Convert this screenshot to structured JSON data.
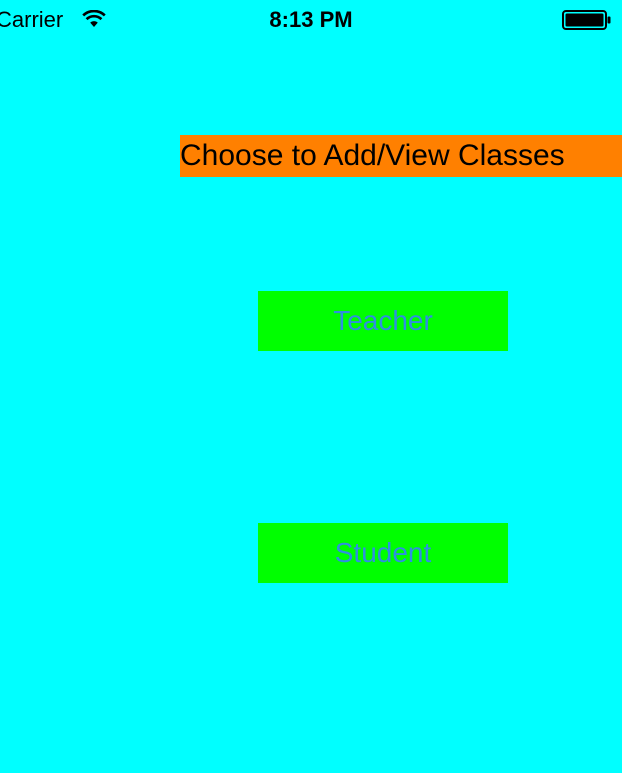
{
  "status_bar": {
    "carrier": "Carrier",
    "time": "8:13 PM",
    "wifi_icon": "wifi-icon",
    "battery_icon": "battery-icon"
  },
  "screen": {
    "title": "Choose to Add/View Classes",
    "teacher_label": "Teacher",
    "student_label": "Student"
  },
  "colors": {
    "background": "#00FFFF",
    "title_background": "#FF8000",
    "button_background": "#00FF00",
    "button_text": "#2F8FE0"
  }
}
